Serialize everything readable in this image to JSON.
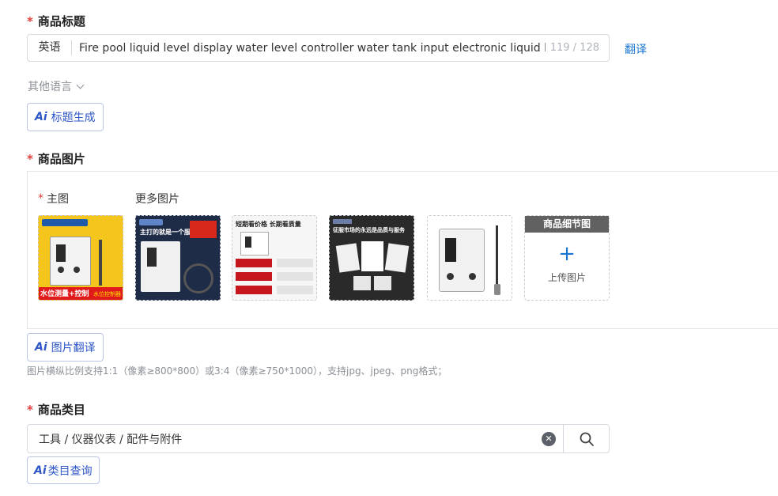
{
  "title_section": {
    "label": "商品标题",
    "language": "英语",
    "value": "Fire pool liquid level display water level controller water tank input electronic liquid level",
    "count": "119 / 128",
    "translate": "翻译",
    "other_languages": "其他语言",
    "ai_button": "标题生成"
  },
  "images_section": {
    "label": "商品图片",
    "main_image_label": "主图",
    "more_images_label": "更多图片",
    "thumbs": [
      {
        "caption": "水位测量+控制",
        "caption2": "水位控制器"
      },
      {
        "caption": "主打的就是一个服务好"
      },
      {
        "caption": "短期看价格 长期看质量"
      },
      {
        "caption": "征服市场的永远是品质与服务"
      },
      {
        "caption": ""
      }
    ],
    "upload": {
      "header": "商品细节图",
      "plus": "+",
      "text": "上传图片"
    },
    "ai_button": "图片翻译",
    "hint": "图片横纵比例支持1:1（像素≥800*800）或3:4（像素≥750*1000），支持jpg、jpeg、png格式；"
  },
  "category_section": {
    "label": "商品类目",
    "value": "工具 / 仪器仪表 / 配件与附件",
    "ai_button": "类目查询"
  },
  "ai_icon_text": "Ai",
  "required_mark": "*",
  "colors": {
    "accent": "#1b76d2",
    "required": "#e43d3d",
    "ai": "#2f57c7"
  }
}
